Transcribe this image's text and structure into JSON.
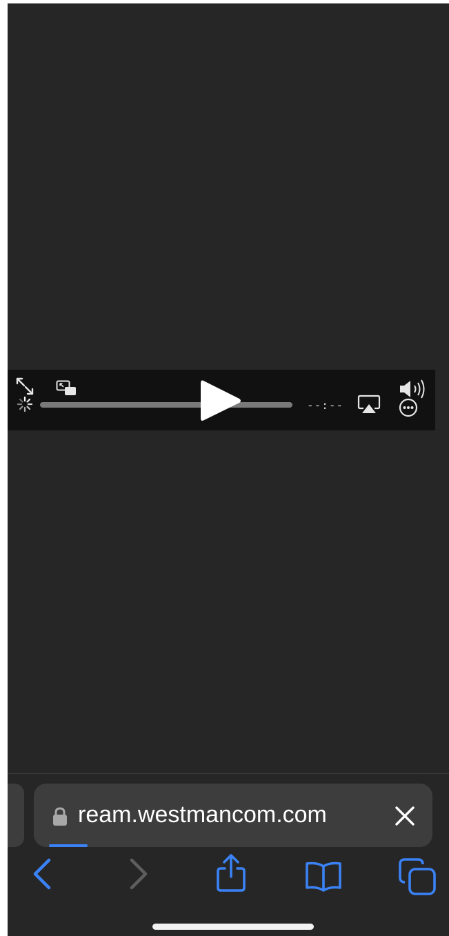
{
  "player": {
    "time_remaining": "--:--",
    "progress": 0,
    "icons": [
      "fullscreen-icon",
      "loading-spinner-icon",
      "picture-in-picture-icon",
      "play-icon",
      "airplay-icon",
      "volume-icon",
      "more-options-icon"
    ]
  },
  "address_bar": {
    "url": "ream.westmancom.com",
    "secure": true,
    "load_progress": 0.1
  },
  "toolbar": {
    "icons": [
      "back-icon",
      "forward-icon",
      "share-icon",
      "bookmarks-icon",
      "tabs-icon"
    ]
  },
  "colors": {
    "background": "#262626",
    "player_bar": "#111111",
    "address_bar": "#3d3d3d",
    "accent": "#3b82f6",
    "disabled": "#5e5e5e"
  }
}
